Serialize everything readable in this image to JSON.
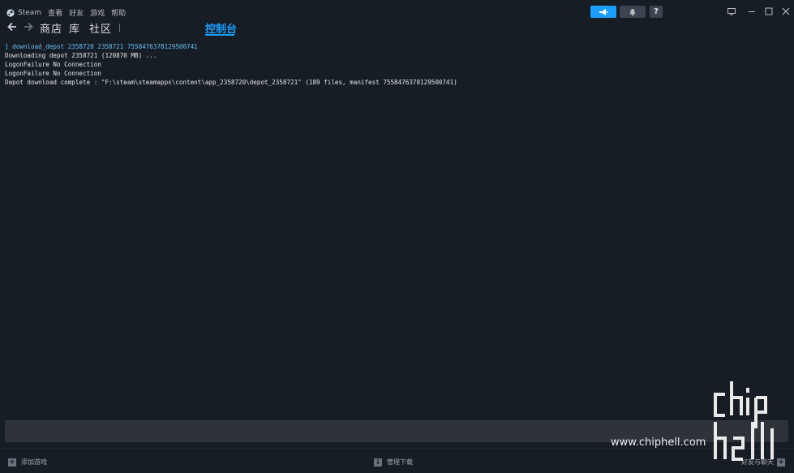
{
  "menu": {
    "app": "Steam",
    "items": [
      "查看",
      "好友",
      "游戏",
      "帮助"
    ]
  },
  "nav": {
    "links": [
      "商店",
      "库",
      "社区"
    ],
    "active_tab": "控制台"
  },
  "help_label": "?",
  "console": {
    "command": "] download_depot 2358720 2358721 7558476378129500741",
    "lines": [
      "Downloading depot 2358721 (120870 MB) ...",
      "LogonFailure No Connection",
      "LogonFailure No Connection",
      "Depot download complete : \"F:\\steam\\steamapps\\content\\app_2358720\\depot_2358721\" (189 files, manifest 7558476378129500741)"
    ]
  },
  "bottom": {
    "add_game": "添加游戏",
    "manage_downloads": "管理下载",
    "friends_chat": "好友与聊天"
  },
  "watermark": {
    "url": "www.chiphell.com",
    "logo": "chip hell"
  },
  "colors": {
    "background": "#171d25",
    "accent": "#1a9fff",
    "input_bar": "#2e333a"
  }
}
